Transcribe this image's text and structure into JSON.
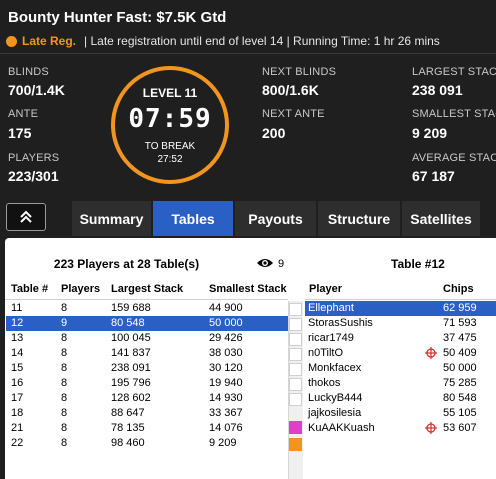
{
  "header": {
    "title": "Bounty Hunter Fast: $7.5K Gtd",
    "reg_status": "Late Reg.",
    "reg_info": "| Late registration until end of level 14 | Running Time: 1 hr  26 mins",
    "accent_color": "#f29520"
  },
  "stats": {
    "blinds_label": "BLINDS",
    "blinds_value": "700/1.4K",
    "ante_label": "ANTE",
    "ante_value": "175",
    "players_label": "PLAYERS",
    "players_value": "223/301",
    "next_blinds_label": "NEXT BLINDS",
    "next_blinds_value": "800/1.6K",
    "next_ante_label": "NEXT ANTE",
    "next_ante_value": "200",
    "largest_stack_label": "LARGEST STACK",
    "largest_stack_value": "238 091",
    "smallest_stack_label": "SMALLEST STACK",
    "smallest_stack_value": "9 209",
    "average_stack_label": "AVERAGE STACK",
    "average_stack_value": "67 187"
  },
  "clock": {
    "level": "LEVEL 11",
    "time": "07:59",
    "to_break_label": "TO BREAK",
    "to_break_time": "27:52"
  },
  "tabs": [
    {
      "label": "Summary",
      "active": false
    },
    {
      "label": "Tables",
      "active": true
    },
    {
      "label": "Payouts",
      "active": false
    },
    {
      "label": "Structure",
      "active": false
    },
    {
      "label": "Satellites",
      "active": false
    }
  ],
  "tables_panel": {
    "summary": "223 Players at 28 Table(s)",
    "watchers": "9",
    "columns": [
      "Table #",
      "Players",
      "Largest Stack",
      "Smallest Stack"
    ],
    "rows": [
      {
        "table": "11",
        "players": "8",
        "largest": "159 688",
        "smallest": "44 900",
        "selected": false
      },
      {
        "table": "12",
        "players": "9",
        "largest": "80 548",
        "smallest": "50 000",
        "selected": true
      },
      {
        "table": "13",
        "players": "8",
        "largest": "100 045",
        "smallest": "29 426",
        "selected": false
      },
      {
        "table": "14",
        "players": "8",
        "largest": "141 837",
        "smallest": "38 030",
        "selected": false
      },
      {
        "table": "15",
        "players": "8",
        "largest": "238 091",
        "smallest": "30 120",
        "selected": false
      },
      {
        "table": "16",
        "players": "8",
        "largest": "195 796",
        "smallest": "19 940",
        "selected": false
      },
      {
        "table": "17",
        "players": "8",
        "largest": "128 602",
        "smallest": "14 930",
        "selected": false
      },
      {
        "table": "18",
        "players": "8",
        "largest": "88 647",
        "smallest": "33 367",
        "selected": false
      },
      {
        "table": "21",
        "players": "8",
        "largest": "78 135",
        "smallest": "14 076",
        "selected": false
      },
      {
        "table": "22",
        "players": "8",
        "largest": "98 460",
        "smallest": "9 209",
        "selected": false
      }
    ]
  },
  "players_panel": {
    "title": "Table #12",
    "columns": [
      "Player",
      "Chips"
    ],
    "rows": [
      {
        "name": "Ellephant",
        "chips": "62 959",
        "selected": true,
        "target": false,
        "swatch": ""
      },
      {
        "name": "StorasSushis",
        "chips": "71 593",
        "selected": false,
        "target": false,
        "swatch": ""
      },
      {
        "name": "ricar1749",
        "chips": "37 475",
        "selected": false,
        "target": false,
        "swatch": ""
      },
      {
        "name": "n0TiltO",
        "chips": "50 409",
        "selected": false,
        "target": true,
        "swatch": ""
      },
      {
        "name": "Monkfacex",
        "chips": "50 000",
        "selected": false,
        "target": false,
        "swatch": ""
      },
      {
        "name": "thokos",
        "chips": "75 285",
        "selected": false,
        "target": false,
        "swatch": ""
      },
      {
        "name": "LuckyB444",
        "chips": "80 548",
        "selected": false,
        "target": false,
        "swatch": ""
      },
      {
        "name": "jajkosilesia",
        "chips": "55 105",
        "selected": false,
        "target": false,
        "swatch": "#e040c8"
      },
      {
        "name": "KuAAKKuash",
        "chips": "53 607",
        "selected": false,
        "target": true,
        "swatch": "#f29520"
      }
    ]
  }
}
